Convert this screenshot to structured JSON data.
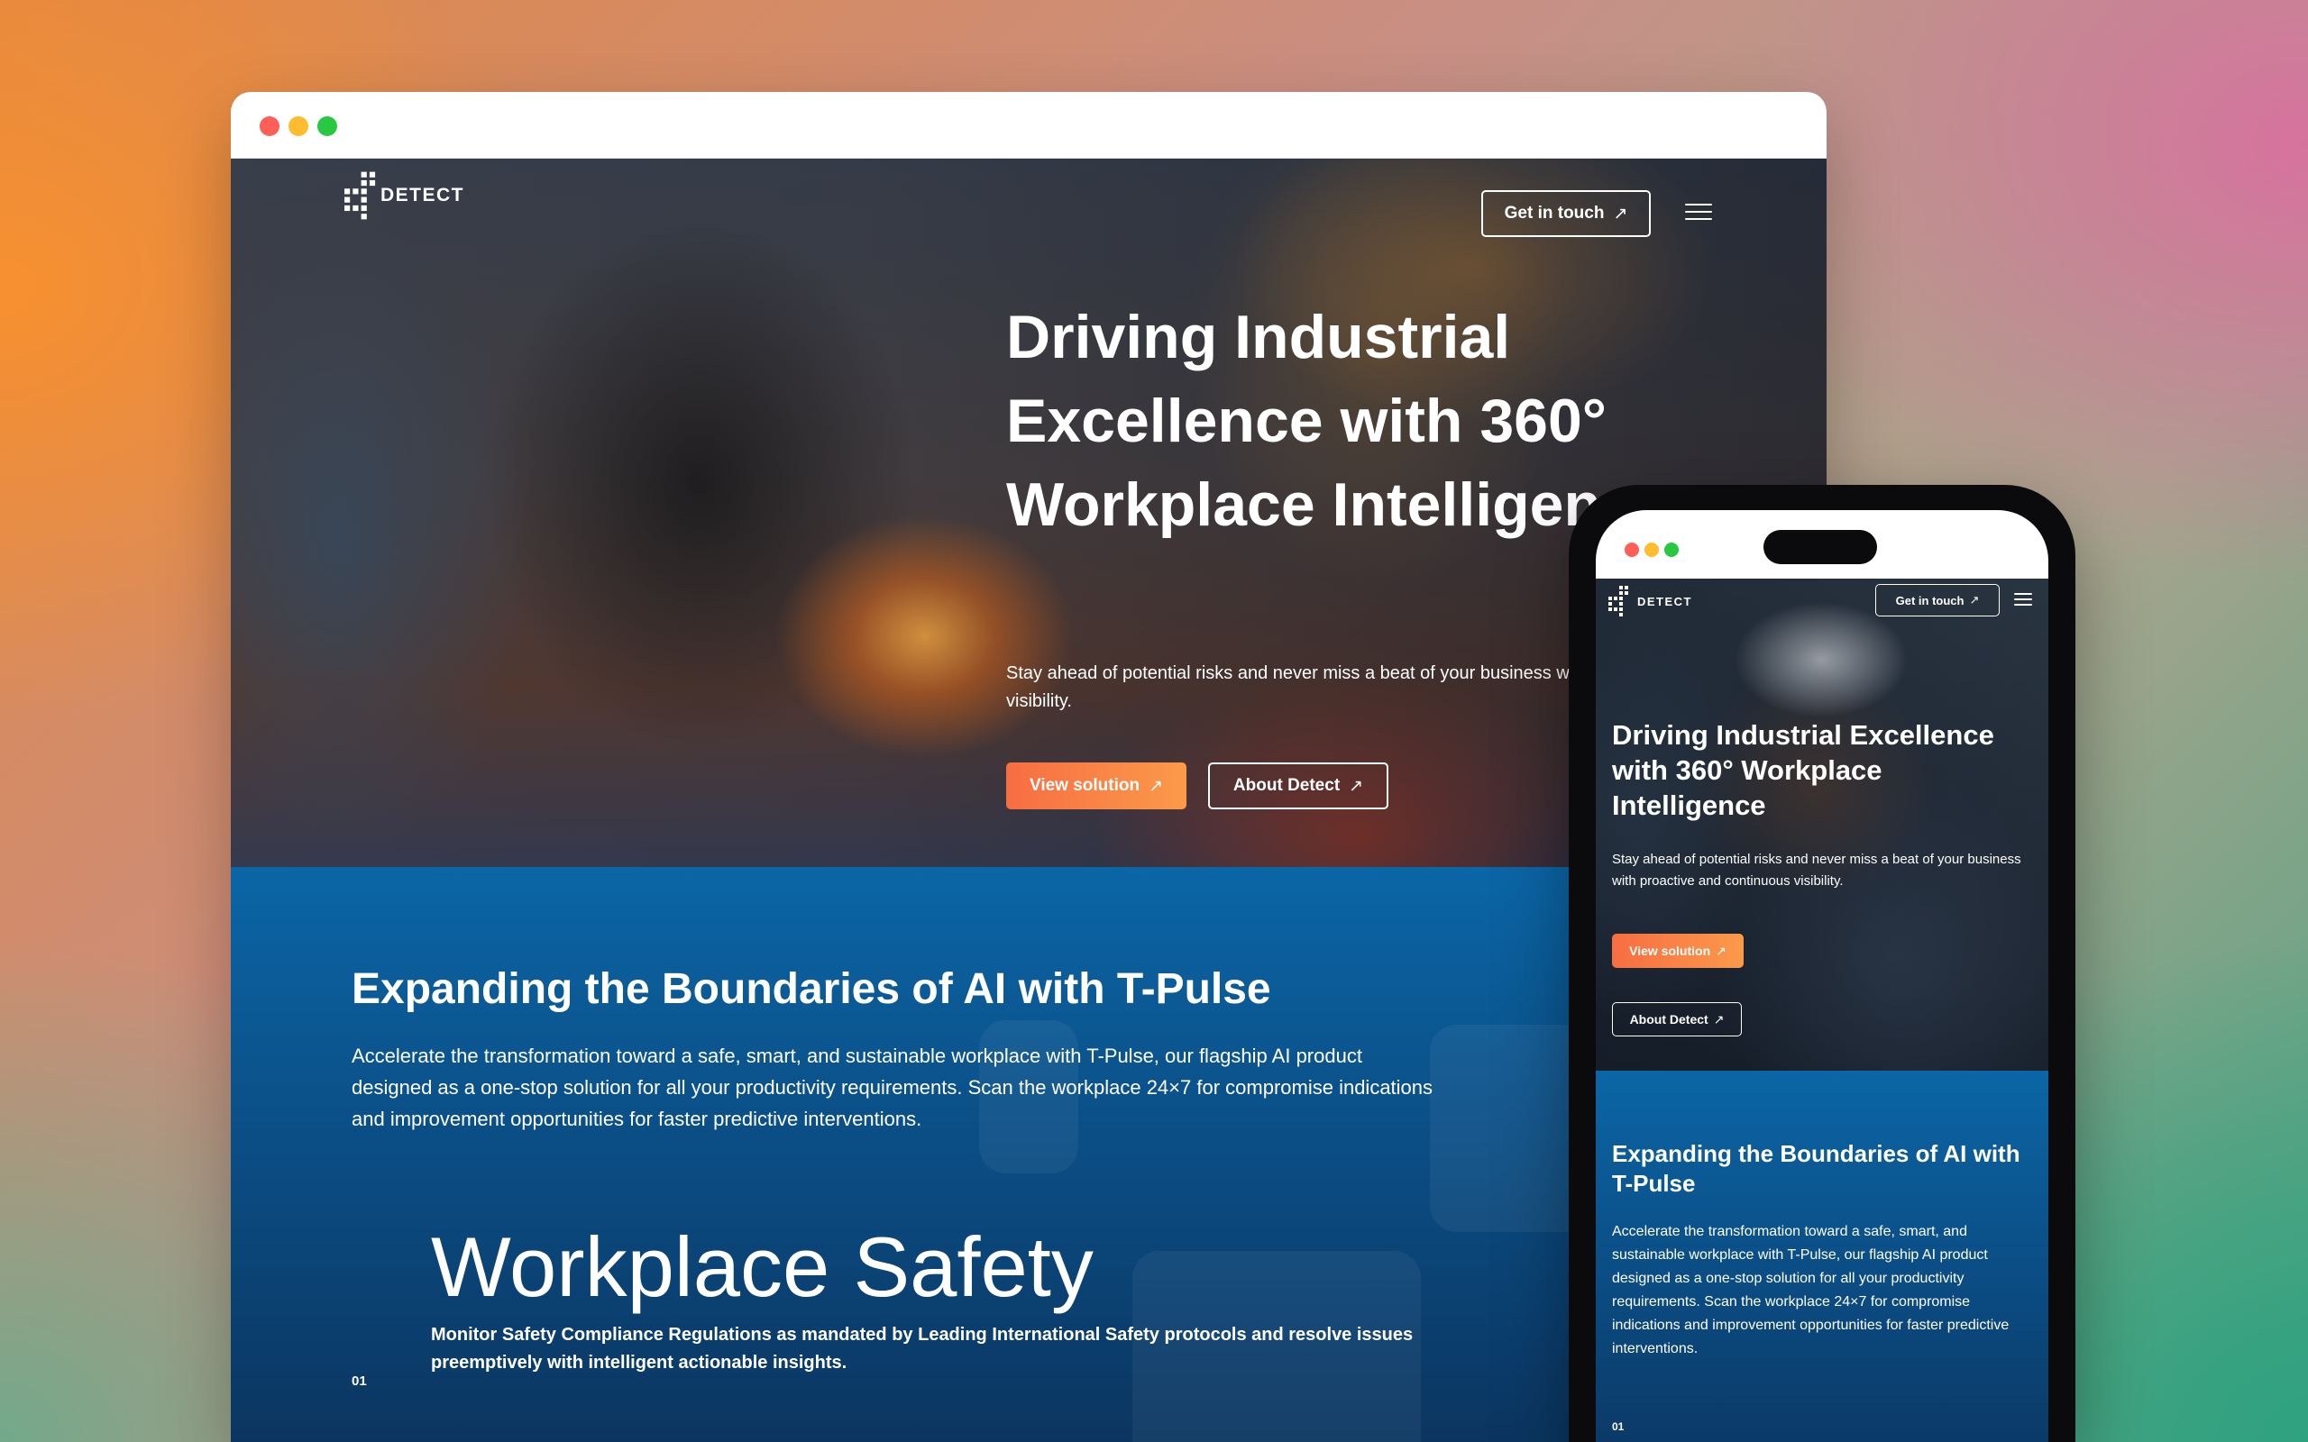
{
  "brand": {
    "name": "DETECT"
  },
  "nav": {
    "cta_label": "Get in touch",
    "arrow_glyph": "↗",
    "menu_icon": "hamburger-menu-icon"
  },
  "hero": {
    "title": "Driving Industrial Excellence with 360° Workplace Intelligence",
    "subtitle": "Stay ahead of potential risks and never miss a beat of your business with proactive and continuous visibility.",
    "primary_button": "View solution",
    "secondary_button": "About Detect"
  },
  "tpulse": {
    "heading": "Expanding the Boundaries of AI with T-Pulse",
    "body": "Accelerate the transformation toward a safe, smart, and sustainable workplace with T-Pulse, our flagship AI product designed as a one-stop solution for all your productivity requirements. Scan the workplace 24×7 for compromise indications and improvement opportunities for faster predictive interventions."
  },
  "features": [
    {
      "number": "01",
      "title": "Workplace Safety",
      "description": "Monitor Safety Compliance Regulations as mandated by Leading International Safety protocols and resolve issues preemptively with intelligent actionable insights."
    }
  ],
  "colors": {
    "accent_orange_start": "#f76d42",
    "accent_orange_end": "#fb9a4a",
    "section_blue": "#0b66a6",
    "section_navy": "#0b3560",
    "mac_red": "#fe5f57",
    "mac_yellow": "#febc2e",
    "mac_green": "#28c840"
  }
}
